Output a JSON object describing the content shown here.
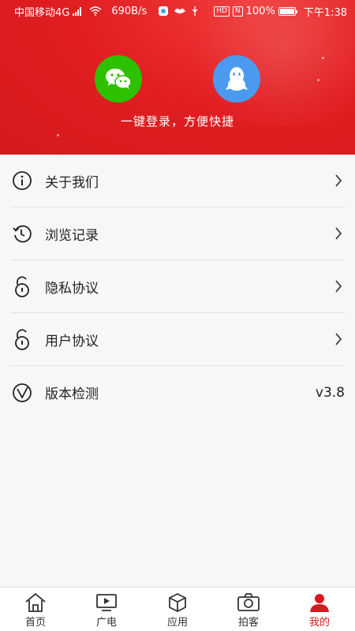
{
  "status_bar": {
    "carrier": "中国移动4G",
    "network_badge": "4G",
    "speed": "690B/s",
    "battery": "100%",
    "time": "下午1:38"
  },
  "login": {
    "wechat_icon": "wechat-icon",
    "qq_icon": "qq-icon",
    "tagline": "一键登录，方便快捷"
  },
  "menu": {
    "items": [
      {
        "label": "关于我们",
        "icon": "info-icon"
      },
      {
        "label": "浏览记录",
        "icon": "history-icon"
      },
      {
        "label": "隐私协议",
        "icon": "lock-icon"
      },
      {
        "label": "用户协议",
        "icon": "lock-icon"
      },
      {
        "label": "版本检测",
        "icon": "version-icon",
        "value": "v3.8"
      }
    ]
  },
  "tabbar": {
    "tabs": [
      {
        "label": "首页",
        "icon": "home-icon"
      },
      {
        "label": "广电",
        "icon": "tv-icon"
      },
      {
        "label": "应用",
        "icon": "box-icon"
      },
      {
        "label": "拍客",
        "icon": "camera-icon"
      },
      {
        "label": "我的",
        "icon": "profile-icon",
        "active": true
      }
    ]
  },
  "colors": {
    "header_red": "#e11e22",
    "wechat_green": "#2dc100",
    "qq_blue": "#4a9bf0",
    "active_tab": "#d8191e"
  }
}
